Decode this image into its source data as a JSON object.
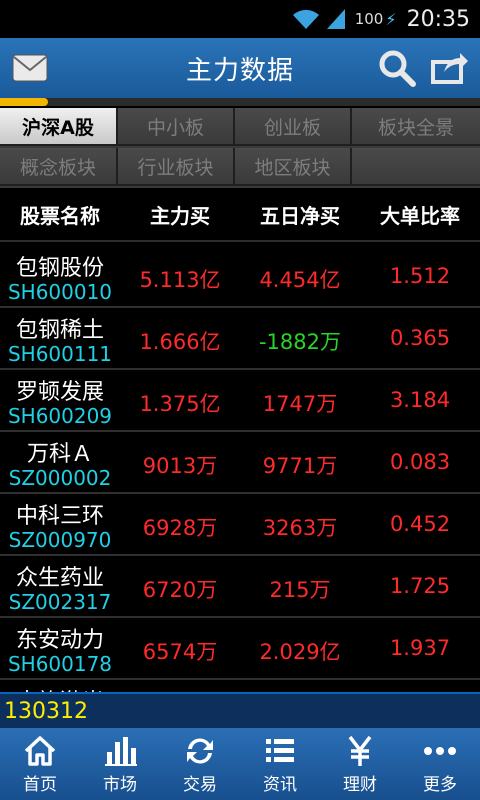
{
  "status_bar": {
    "battery": "100",
    "time": "20:35"
  },
  "header": {
    "title": "主力数据"
  },
  "progress": {
    "fraction": 0.1
  },
  "tabs": [
    {
      "label": "沪深A股",
      "active": true
    },
    {
      "label": "中小板",
      "active": false
    },
    {
      "label": "创业板",
      "active": false
    },
    {
      "label": "板块全景",
      "active": false
    },
    {
      "label": "概念板块",
      "active": false
    },
    {
      "label": "行业板块",
      "active": false
    },
    {
      "label": "地区板块",
      "active": false
    },
    {
      "label": "",
      "active": false
    }
  ],
  "columns": [
    "股票名称",
    "主力买",
    "五日净买",
    "大单比率"
  ],
  "rows": [
    {
      "name": "包钢股份",
      "code": "SH600010",
      "main_buy": "5.113亿",
      "five_day": "4.454亿",
      "five_day_color": "red",
      "ratio": "1.512"
    },
    {
      "name": "包钢稀土",
      "code": "SH600111",
      "main_buy": "1.666亿",
      "five_day": "-1882万",
      "five_day_color": "green",
      "ratio": "0.365"
    },
    {
      "name": "罗顿发展",
      "code": "SH600209",
      "main_buy": "1.375亿",
      "five_day": "1747万",
      "five_day_color": "red",
      "ratio": "3.184"
    },
    {
      "name": "万科Ａ",
      "code": "SZ000002",
      "main_buy": "9013万",
      "five_day": "9771万",
      "five_day_color": "red",
      "ratio": "0.083"
    },
    {
      "name": "中科三环",
      "code": "SZ000970",
      "main_buy": "6928万",
      "five_day": "3263万",
      "five_day_color": "red",
      "ratio": "0.452"
    },
    {
      "name": "众生药业",
      "code": "SZ002317",
      "main_buy": "6720万",
      "five_day": "215万",
      "five_day_color": "red",
      "ratio": "1.725"
    },
    {
      "name": "东安动力",
      "code": "SH600178",
      "main_buy": "6574万",
      "five_day": "2.029亿",
      "five_day_color": "red",
      "ratio": "1.937"
    },
    {
      "name": "大族激光",
      "code": "",
      "main_buy": "",
      "five_day": "",
      "five_day_color": "red",
      "ratio": ""
    }
  ],
  "code_bar": {
    "value": "130312"
  },
  "nav": [
    {
      "label": "首页",
      "icon": "home-icon"
    },
    {
      "label": "市场",
      "icon": "bar-chart-icon"
    },
    {
      "label": "交易",
      "icon": "exchange-icon"
    },
    {
      "label": "资讯",
      "icon": "list-icon"
    },
    {
      "label": "理财",
      "icon": "yuan-icon"
    },
    {
      "label": "更多",
      "icon": "more-icon"
    }
  ],
  "colors": {
    "accent": "#f3b600",
    "header_blue": "#1a5a9a",
    "up": "#ff2a2a",
    "down": "#28d428",
    "code": "#1fd0e6"
  }
}
